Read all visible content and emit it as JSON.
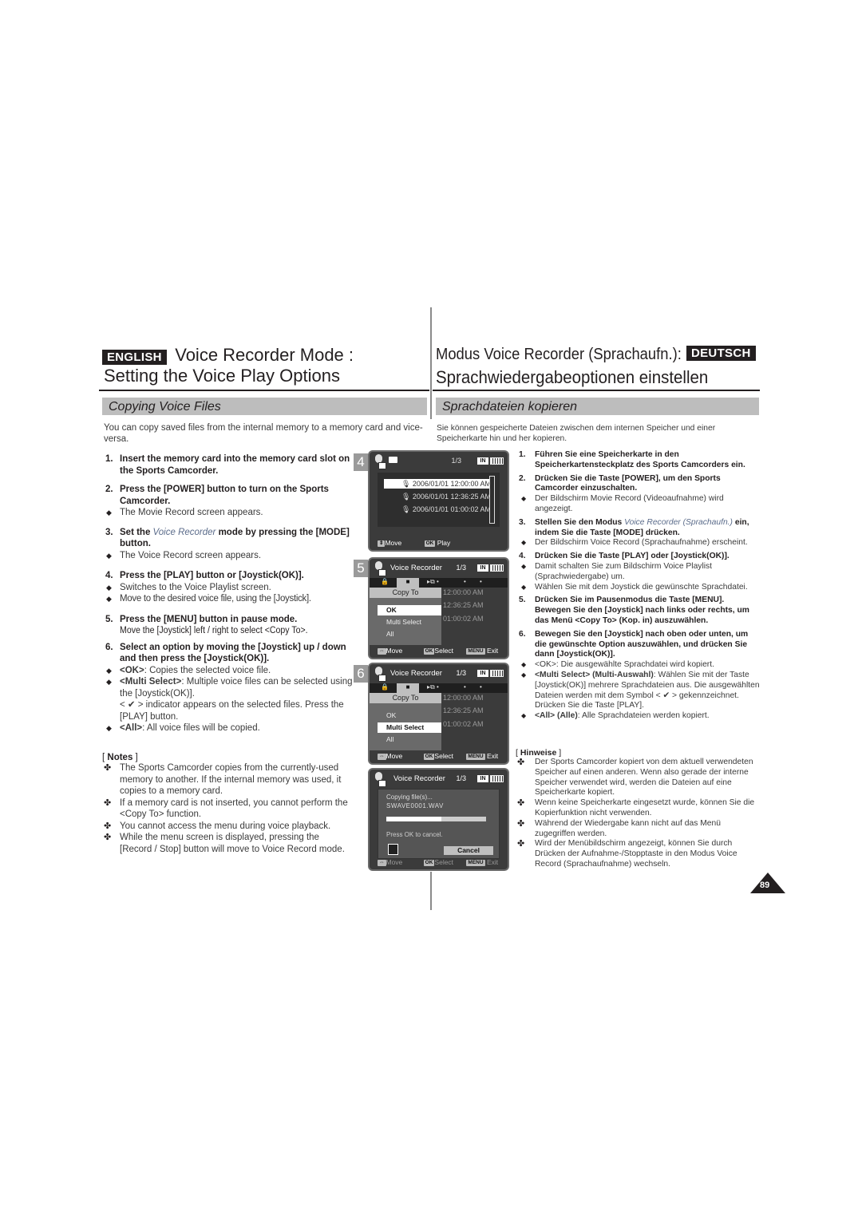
{
  "header": {
    "en_badge": "ENGLISH",
    "en_title_line1": "Voice Recorder Mode :",
    "en_title_line2": "Setting the Voice Play Options",
    "de_title_line1": "Modus Voice Recorder (Sprachaufn.):",
    "de_badge": "DEUTSCH",
    "de_title_line2": "Sprachwiedergabeoptionen einstellen"
  },
  "english": {
    "section_title": "Copying Voice Files",
    "intro": "You can copy saved files from the internal memory to a memory card and vice-versa.",
    "steps": [
      {
        "num": "1.",
        "text": "Insert the memory card into the memory card slot on the Sports Camcorder."
      },
      {
        "num": "2.",
        "text": "Press the [POWER] button to turn on the Sports Camcorder.",
        "bullets": [
          "The Movie Record screen appears."
        ]
      },
      {
        "num": "3.",
        "pre": "Set the ",
        "italic": "Voice Recorder",
        "post": " mode by pressing the [MODE] button.",
        "bullets": [
          "The Voice Record screen appears."
        ]
      },
      {
        "num": "4.",
        "text": "Press the [PLAY] button or [Joystick(OK)].",
        "bullets": [
          "Switches to the Voice Playlist screen.",
          "Move to the desired voice file, using the [Joystick]."
        ]
      },
      {
        "num": "5.",
        "text": "Press the [MENU] button in pause mode.",
        "sub": "Move the [Joystick] left / right to select <Copy To>."
      },
      {
        "num": "6.",
        "text": "Select an option by moving the [Joystick] up / down and then press the [Joystick(OK)].",
        "bullets": [
          {
            "label": "<OK>",
            "text": ": Copies the selected voice file."
          },
          {
            "label": "<Multi Select>",
            "text": ": Multiple voice files can be selected using the [Joystick(OK)].",
            "extra": "< ✔ > indicator appears on the selected files. Press the [PLAY] button."
          },
          {
            "label": "<All>",
            "text": ": All voice files will be copied."
          }
        ]
      }
    ],
    "notes_title": "Notes",
    "notes": [
      "The Sports Camcorder copies from the currently-used memory to another. If the internal memory was used, it copies to a memory card.",
      "If a memory card is not inserted, you cannot perform the <Copy To> function.",
      "You cannot access the menu during voice playback.",
      "While the menu screen is displayed, pressing the [Record / Stop] button will move to Voice  Record mode."
    ]
  },
  "deutsch": {
    "section_title": "Sprachdateien kopieren",
    "intro": "Sie können gespeicherte Dateien zwischen dem internen Speicher und einer Speicherkarte hin und her kopieren.",
    "steps": [
      {
        "num": "1.",
        "text": "Führen Sie eine Speicherkarte in den Speicherkartensteckplatz des Sports Camcorders ein."
      },
      {
        "num": "2.",
        "text": "Drücken Sie die Taste [POWER], um den Sports Camcorder einzuschalten.",
        "bullets": [
          "Der Bildschirm Movie Record (Videoaufnahme) wird angezeigt."
        ]
      },
      {
        "num": "3.",
        "pre": "Stellen Sie den Modus ",
        "italic": "Voice Recorder (Sprachaufn.)",
        "post": " ein, indem Sie die Taste [MODE] drücken.",
        "bullets": [
          "Der Bildschirm Voice Record (Sprachaufnahme) erscheint."
        ]
      },
      {
        "num": "4.",
        "text": "Drücken Sie die Taste [PLAY] oder [Joystick(OK)].",
        "bullets": [
          "Damit schalten Sie zum Bildschirm Voice Playlist (Sprachwiedergabe) um.",
          "Wählen Sie mit dem Joystick die gewünschte Sprachdatei."
        ]
      },
      {
        "num": "5.",
        "text": "Drücken Sie im Pausenmodus die Taste [MENU]. Bewegen Sie den [Joystick] nach links oder rechts, um das Menü <Copy To> (Kop. in) auszuwählen."
      },
      {
        "num": "6.",
        "text": "Bewegen Sie den [Joystick] nach oben oder unten, um die gewünschte Option auszuwählen, und drücken Sie dann [Joystick(OK)].",
        "bullets": [
          {
            "label": "<OK>",
            "text": ": Die ausgewählte Sprachdatei wird kopiert."
          },
          {
            "label": "<Multi Select> (Multi-Auswahl)",
            "text": ": Wählen Sie mit der Taste [Joystick(OK)] mehrere Sprachdateien aus. Die ausgewählten Dateien werden mit dem Symbol < ✔ > gekennzeichnet. Drücken Sie die Taste [PLAY]."
          },
          {
            "label": "<All> (Alle)",
            "text": ": Alle Sprachdateien werden kopiert."
          }
        ]
      }
    ],
    "notes_title": "Hinweise",
    "notes": [
      "Der Sports Camcorder kopiert von dem aktuell verwendeten Speicher auf einen anderen. Wenn also gerade der interne Speicher verwendet wird, werden die Dateien auf eine Speicherkarte kopiert.",
      "Wenn keine Speicherkarte eingesetzt wurde, können Sie die Kopierfunktion nicht verwenden.",
      "Während der Wiedergabe kann nicht auf das Menü zugegriffen werden.",
      "Wird der Menübildschirm angezeigt, können Sie durch Drücken der Aufnahme-/Stopptaste in den Modus Voice Record (Sprachaufnahme) wechseln."
    ]
  },
  "screens": {
    "s4": {
      "num": "4",
      "counter": "1/3",
      "memory": "IN",
      "files": [
        "2006/01/01 12:00:00 AM",
        "2006/01/01 12:36:25 AM",
        "2006/01/01 01:00:02 AM"
      ],
      "selected_index": 0,
      "footer_move": "Move",
      "footer_ok_key": "OK",
      "footer_ok": "Play"
    },
    "s5": {
      "num": "5",
      "title": "Voice Recorder",
      "counter": "1/3",
      "memory": "IN",
      "menu_header": "Copy To",
      "options": [
        "OK",
        "Multi Select",
        "All"
      ],
      "selected": "OK",
      "ghost_times": [
        "12:00:00 AM",
        "12:36:25 AM",
        "01:00:02 AM"
      ],
      "footer_move": "Move",
      "footer_ok_key": "OK",
      "footer_select": "Select",
      "footer_menu_key": "MENU",
      "footer_exit": "Exit"
    },
    "s6": {
      "num": "6",
      "title": "Voice Recorder",
      "counter": "1/3",
      "memory": "IN",
      "menu_header": "Copy To",
      "options": [
        "OK",
        "Multi Select",
        "All"
      ],
      "selected": "Multi Select",
      "ghost_times": [
        "12:00:00 AM",
        "12:36:25 AM",
        "01:00:02 AM"
      ],
      "footer_move": "Move",
      "footer_ok_key": "OK",
      "footer_select": "Select",
      "footer_menu_key": "MENU",
      "footer_exit": "Exit"
    },
    "s7": {
      "title": "Voice Recorder",
      "counter": "1/3",
      "memory": "IN",
      "copying": "Copying file(s)...",
      "filename": "SWAVE0001.WAV",
      "progress_percent": 55,
      "press_ok": "Press OK to cancel.",
      "cancel": "Cancel",
      "footer_move": "Move",
      "footer_ok_key": "OK",
      "footer_select": "Select",
      "footer_menu_key": "MENU",
      "footer_exit": "Exit"
    }
  },
  "page_number": "89"
}
